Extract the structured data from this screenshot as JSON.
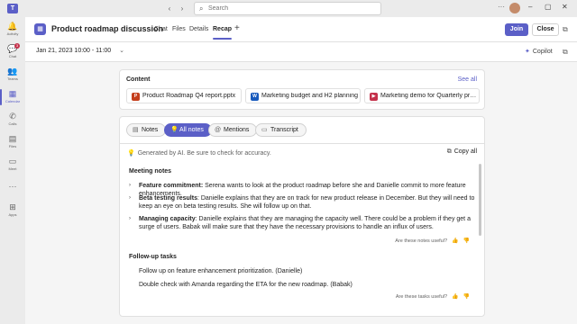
{
  "titlebar": {
    "app_logo": "T",
    "back_icon": "‹",
    "forward_icon": "›",
    "search_placeholder": "Search",
    "search_icon": "⌕",
    "more_icon": "···",
    "window_controls": [
      "–",
      "▢",
      "✕"
    ]
  },
  "rail": {
    "items": [
      {
        "label": "Activity",
        "icon": "bell-icon",
        "glyph": "🔔"
      },
      {
        "label": "Chat",
        "icon": "chat-icon",
        "glyph": "💬",
        "badge": "3"
      },
      {
        "label": "Teams",
        "icon": "teams-icon",
        "glyph": "👥"
      },
      {
        "label": "Calendar",
        "icon": "calendar-icon",
        "glyph": "▦",
        "active": true
      },
      {
        "label": "Calls",
        "icon": "phone-icon",
        "glyph": "✆"
      },
      {
        "label": "Files",
        "icon": "file-icon",
        "glyph": "▤"
      },
      {
        "label": "Meet",
        "icon": "video-icon",
        "glyph": "▭"
      },
      {
        "label": "",
        "icon": "more-apps-icon",
        "glyph": "···"
      },
      {
        "label": "Apps",
        "icon": "apps-icon",
        "glyph": "⊞"
      }
    ]
  },
  "meeting": {
    "title": "Product roadmap discussion",
    "tabs": [
      "Chat",
      "Files",
      "Details",
      "Recap"
    ],
    "active_tab": "Recap",
    "add_tab": "+",
    "join_label": "Join",
    "close_label": "Close",
    "accent": "#5b5fc7"
  },
  "daterow": {
    "date_range": "Jan 21, 2023 10:00 - 11:00",
    "chevron": "⌄",
    "copilot_label": "Copilot",
    "copilot_icon": "✦"
  },
  "content": {
    "title": "Content",
    "see_all": "See all",
    "files": [
      {
        "name": "Product Roadmap Q4 report.pptx",
        "type": "P",
        "color": "#c43e1c"
      },
      {
        "name": "Marketing budget and H2 planning",
        "type": "W",
        "color": "#185abd"
      },
      {
        "name": "Marketing demo for Quarterly product update",
        "type": "▶",
        "color": "#c4314b"
      }
    ]
  },
  "notes": {
    "pills": [
      {
        "label": "Notes",
        "glyph": "▤"
      },
      {
        "label": "All notes",
        "glyph": "💡",
        "active": true
      },
      {
        "label": "Mentions",
        "glyph": "@"
      },
      {
        "label": "Transcript",
        "glyph": "▭"
      }
    ],
    "ai_disclaimer": "Generated by AI. Be sure to check for accuracy.",
    "ai_icon": "💡",
    "copy_all": "Copy all",
    "meeting_notes_title": "Meeting notes",
    "meeting_notes": [
      {
        "heading": "Feature commitment:",
        "text": " Serena wants to look at the product roadmap before she and Danielle commit to more feature enhancements."
      },
      {
        "heading": "Beta testing results",
        "text": ": Danielle explains that they are on track for new product release in December. But they will need to keep an eye on beta testing results. She will follow up on that."
      },
      {
        "heading": "Managing capacity",
        "text": ": Danielle explains that they are managing the capacity well. There could be a problem if they get a surge of users. Babak will make sure that they have the necessary provisions to handle an influx of users."
      }
    ],
    "notes_feedback": "Are these notes useful?",
    "followup_title": "Follow-up tasks",
    "tasks": [
      "Follow up on feature enhancement prioritization. (Danielle)",
      "Double check with Amanda regarding the ETA for the new roadmap. (Babak)"
    ],
    "tasks_feedback": "Are these tasks useful?",
    "thumbs_up": "👍",
    "thumbs_down": "👎"
  }
}
